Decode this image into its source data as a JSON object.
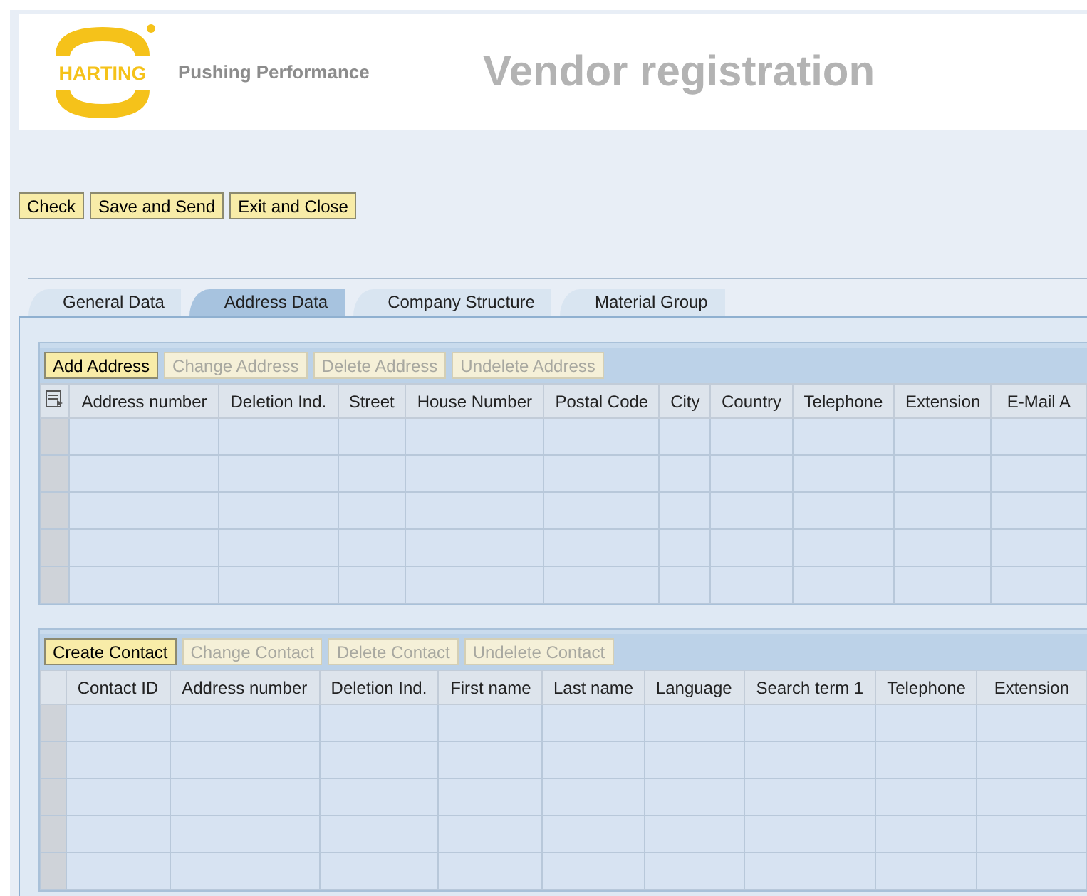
{
  "header": {
    "logo_text": "HARTING",
    "tagline": "Pushing Performance",
    "title": "Vendor registration"
  },
  "actions": [
    {
      "label": "Check"
    },
    {
      "label": "Save and Send"
    },
    {
      "label": "Exit and Close"
    }
  ],
  "tabs": [
    {
      "label": "General Data",
      "selected": false
    },
    {
      "label": "Address Data",
      "selected": true
    },
    {
      "label": "Company Structure",
      "selected": false
    },
    {
      "label": "Material Group",
      "selected": false
    }
  ],
  "address_table": {
    "buttons": [
      {
        "label": "Add Address",
        "disabled": false
      },
      {
        "label": "Change Address",
        "disabled": true
      },
      {
        "label": "Delete Address",
        "disabled": true
      },
      {
        "label": "Undelete Address",
        "disabled": true
      }
    ],
    "columns": [
      "Address number",
      "Deletion Ind.",
      "Street",
      "House Number",
      "Postal Code",
      "City",
      "Country",
      "Telephone",
      "Extension",
      "E-Mail A"
    ]
  },
  "contact_table": {
    "buttons": [
      {
        "label": "Create Contact",
        "disabled": false
      },
      {
        "label": "Change Contact",
        "disabled": true
      },
      {
        "label": "Delete Contact",
        "disabled": true
      },
      {
        "label": "Undelete Contact",
        "disabled": true
      }
    ],
    "columns": [
      "Contact ID",
      "Address number",
      "Deletion Ind.",
      "First name",
      "Last name",
      "Language",
      "Search term 1",
      "Telephone",
      "Extension"
    ]
  }
}
